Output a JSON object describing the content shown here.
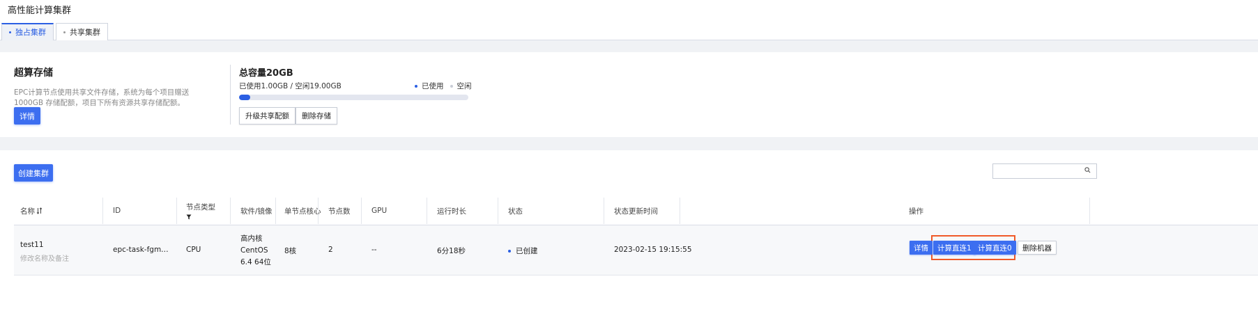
{
  "page": {
    "title": "高性能计算集群"
  },
  "tabs": [
    {
      "label": "独占集群",
      "active": true
    },
    {
      "label": "共享集群",
      "active": false
    }
  ],
  "storage": {
    "title": "超算存储",
    "description": "EPC计算节点使用共享文件存储，系统为每个项目赠送 1000GB 存储配额，项目下所有资源共享存储配额。",
    "detail_label": "详情",
    "capacity_title": "总容量20GB",
    "usage_text": "已使用1.00GB / 空闲19.00GB",
    "used_fraction": 0.05,
    "legend_used": "已使用",
    "legend_free": "空闲",
    "upgrade_label": "升级共享配额",
    "delete_label": "删除存储",
    "colors": {
      "used": "#2b5fe3",
      "free": "#e3e6ef"
    }
  },
  "clusters": {
    "create_label": "创建集群",
    "search": {
      "placeholder": "",
      "icon": "search-icon"
    },
    "columns": {
      "name": "名称",
      "id": "ID",
      "node_type": "节点类型",
      "software": "软件/镜像",
      "cores": "单节点核心数",
      "nodes": "节点数",
      "gpu": "GPU",
      "uptime": "运行时长",
      "status": "状态",
      "updated": "状态更新时间",
      "actions": "操作"
    },
    "rows": [
      {
        "name": "test11",
        "remark_hint": "修改名称及备注",
        "id": "epc-task-fgm…",
        "node_type": "CPU",
        "software_line1": "高内核",
        "software_line2": "CentOS",
        "software_line3": "6.4 64位",
        "cores": "8核",
        "nodes": "2",
        "gpu": "--",
        "uptime": "6分18秒",
        "status": "已创建",
        "updated": "2023-02-15 19:15:55",
        "actions": {
          "detail": "详情",
          "connect1": "计算直连1",
          "connect0": "计算直连0",
          "delete": "删除机器"
        }
      }
    ],
    "accent": "#3c6ef0",
    "highlight_color": "#f05a28"
  }
}
